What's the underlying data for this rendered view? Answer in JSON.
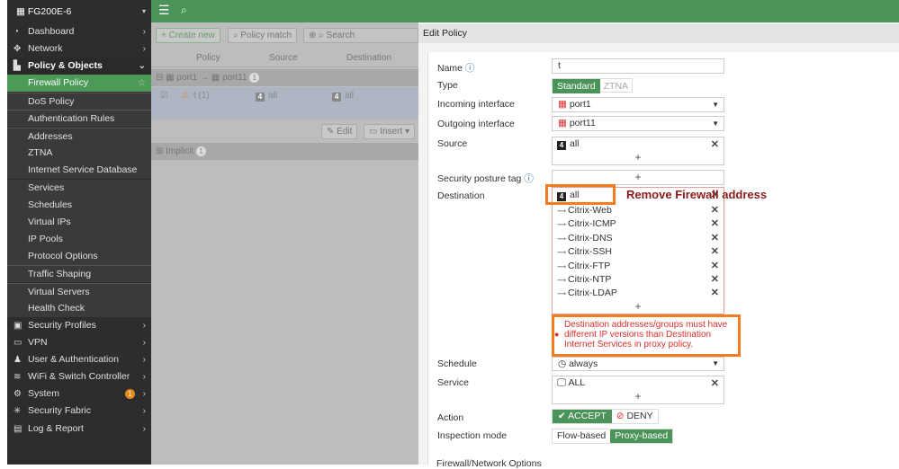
{
  "device": "FG200E-6",
  "sidebar": {
    "items": [
      {
        "label": "Dashboard"
      },
      {
        "label": "Network"
      },
      {
        "label": "Policy & Objects"
      },
      {
        "label": "Firewall Policy"
      },
      {
        "label": "DoS Policy"
      },
      {
        "label": "Authentication Rules"
      },
      {
        "label": "Addresses"
      },
      {
        "label": "ZTNA"
      },
      {
        "label": "Internet Service Database"
      },
      {
        "label": "Services"
      },
      {
        "label": "Schedules"
      },
      {
        "label": "Virtual IPs"
      },
      {
        "label": "IP Pools"
      },
      {
        "label": "Protocol Options"
      },
      {
        "label": "Traffic Shaping"
      },
      {
        "label": "Virtual Servers"
      },
      {
        "label": "Health Check"
      },
      {
        "label": "Security Profiles"
      },
      {
        "label": "VPN"
      },
      {
        "label": "User & Authentication"
      },
      {
        "label": "WiFi & Switch Controller"
      },
      {
        "label": "System",
        "badge": "1"
      },
      {
        "label": "Security Fabric"
      },
      {
        "label": "Log & Report"
      }
    ]
  },
  "toolbar": {
    "create_new": "Create new",
    "policy_match": "Policy match",
    "search_placeholder": "Search"
  },
  "table": {
    "columns": [
      "Policy",
      "Source",
      "Destination"
    ],
    "group": {
      "from": "port1",
      "to": "port11",
      "count": "1"
    },
    "row": {
      "policy": "t (1)",
      "source": "all",
      "destination": "all"
    },
    "edit": "Edit",
    "insert": "Insert",
    "implicit": "Implicit",
    "implicit_count": "1"
  },
  "edit_policy": {
    "title": "Edit Policy",
    "labels": {
      "name": "Name",
      "type": "Type",
      "incoming": "Incoming interface",
      "outgoing": "Outgoing interface",
      "source": "Source",
      "posture": "Security posture tag",
      "destination": "Destination",
      "schedule": "Schedule",
      "service": "Service",
      "action": "Action",
      "inspection": "Inspection mode"
    },
    "name": "t",
    "type_options": [
      "Standard",
      "ZTNA"
    ],
    "incoming": "port1",
    "outgoing": "port11",
    "source": "all",
    "destination": [
      "all",
      "Citrix-Web",
      "Citrix-ICMP",
      "Citrix-DNS",
      "Citrix-SSH",
      "Citrix-FTP",
      "Citrix-NTP",
      "Citrix-LDAP"
    ],
    "error": "Destination addresses/groups must have different IP versions than Destination Internet Services in proxy policy.",
    "schedule": "always",
    "service": "ALL",
    "accept": "ACCEPT",
    "deny": "DENY",
    "inspection_options": [
      "Flow-based",
      "Proxy-based"
    ],
    "section": "Firewall/Network Options"
  },
  "annotation": "Remove Firewall address",
  "colors": {
    "brand_green": "#4a9359",
    "highlight": "#f47c20",
    "error": "#d9302c"
  }
}
